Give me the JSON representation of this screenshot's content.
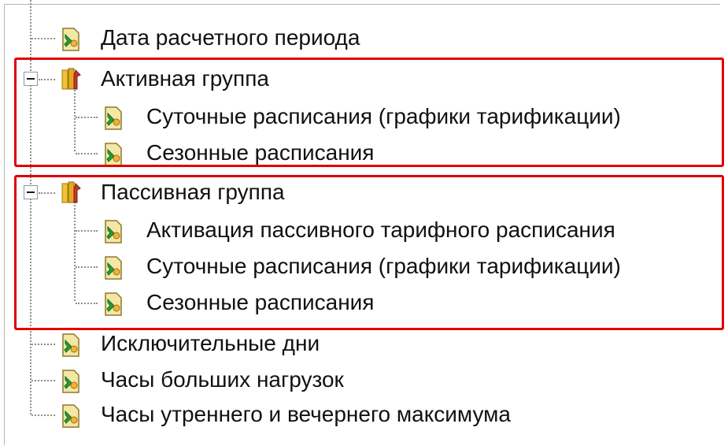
{
  "tree": {
    "items": [
      {
        "label": "Дата расчетного периода",
        "icon": "parameter-icon"
      },
      {
        "label": "Активная группа",
        "icon": "tools-group-icon",
        "expanded": true,
        "children": [
          {
            "label": "Суточные расписания (графики тарификации)",
            "icon": "parameter-icon"
          },
          {
            "label": "Сезонные расписания",
            "icon": "parameter-icon"
          }
        ]
      },
      {
        "label": "Пассивная группа",
        "icon": "tools-group-icon",
        "expanded": true,
        "children": [
          {
            "label": "Активация пассивного тарифного расписания",
            "icon": "parameter-icon"
          },
          {
            "label": "Суточные расписания (графики тарификации)",
            "icon": "parameter-icon"
          },
          {
            "label": "Сезонные расписания",
            "icon": "parameter-icon"
          }
        ]
      },
      {
        "label": "Исключительные дни",
        "icon": "parameter-icon"
      },
      {
        "label": "Часы больших нагрузок",
        "icon": "parameter-icon"
      },
      {
        "label": "Часы утреннего и вечернего максимума",
        "icon": "parameter-icon"
      }
    ]
  },
  "highlight": {
    "color": "#e00000"
  }
}
